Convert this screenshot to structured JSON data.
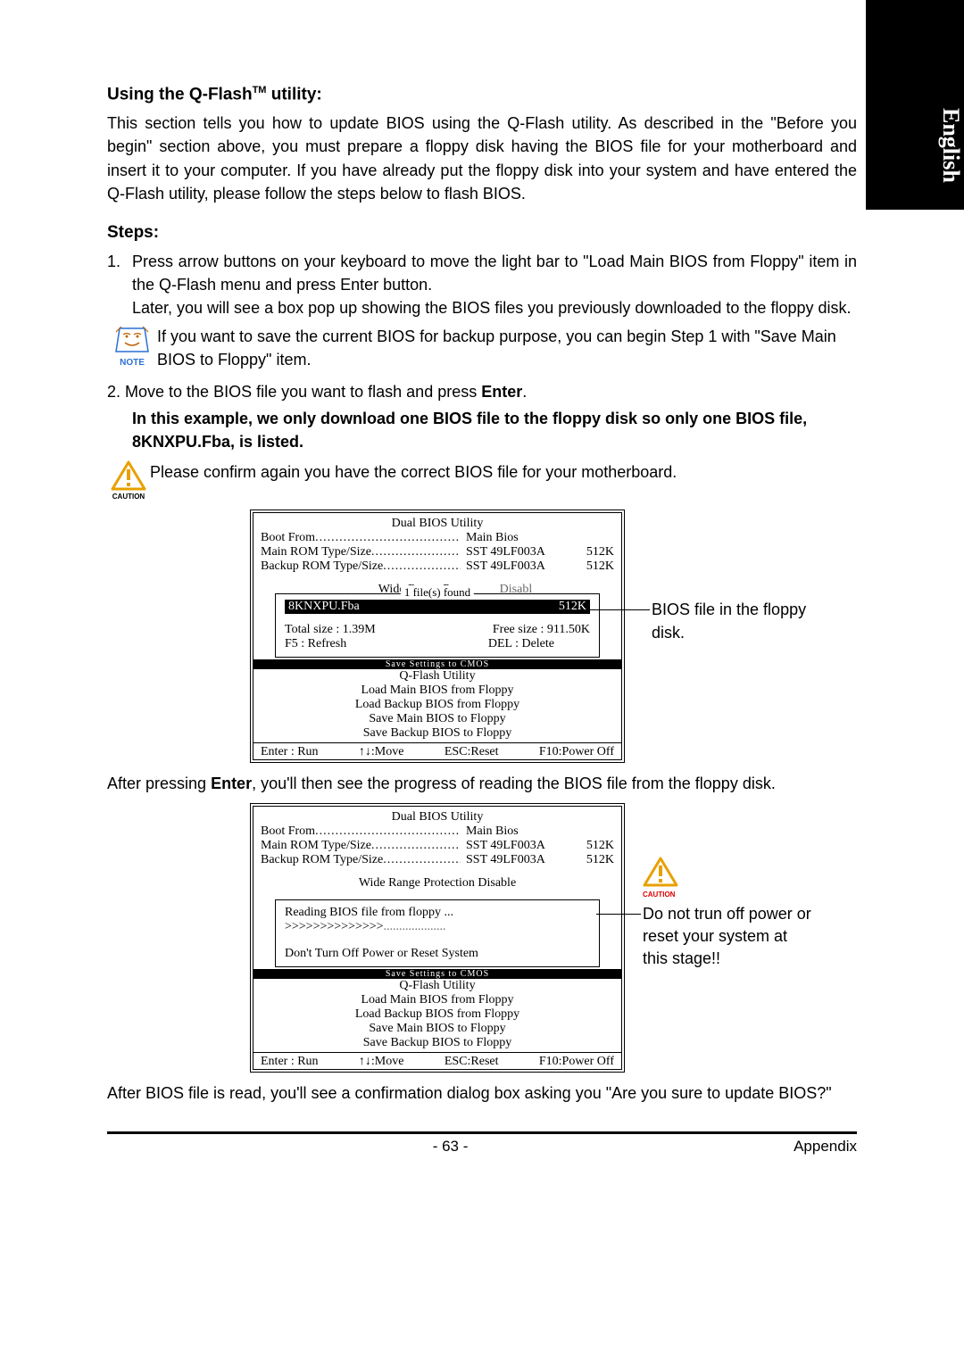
{
  "sidetab": "English",
  "heading1_pre": "Using the Q-Flash",
  "heading1_tm": "TM",
  "heading1_post": " utility:",
  "intro": "This section tells you how to update BIOS using the Q-Flash utility. As described in the \"Before you begin\" section above, you must prepare a floppy disk having the BIOS file for your motherboard and insert it to your computer. If you have already put the floppy disk into your system and have entered the Q-Flash utility, please follow the steps below to flash BIOS.",
  "steps_h": "Steps:",
  "step1_num": "1.",
  "step1a": "Press arrow buttons on your keyboard to move the light bar to \"Load Main BIOS from Floppy\" item in the Q-Flash menu and press Enter button.",
  "step1b": "Later, you will see a box pop up showing the BIOS files you previously downloaded to the floppy disk.",
  "note_label": "NOTE",
  "note_text": "If you want to save the current BIOS for backup purpose, you can begin Step 1 with \"Save Main BIOS to Floppy\" item.",
  "step2_pre": "2. Move to the BIOS file you want to flash and press ",
  "step2_enter": "Enter",
  "step2_post": ".",
  "example_line": "In this example, we only download one BIOS file to the floppy disk so only one BIOS file, 8KNXPU.Fba, is listed.",
  "caution_label": "CAUTION",
  "caution_text": "Please confirm again you have the correct BIOS file for your motherboard.",
  "bios1": {
    "title": "Dual BIOS Utility",
    "boot_from_l": "Boot From",
    "boot_from_v": "Main Bios",
    "main_rom_l": "Main ROM Type/Size",
    "main_rom_v": "SST 49LF003A",
    "main_rom_s": "512K",
    "backup_rom_l": "Backup ROM Type/Size",
    "backup_rom_v": "SST 49LF003A",
    "backup_rom_s": "512K",
    "wrp": "Wide Range Prot",
    "wrp_val_partial": "Disabl",
    "popup_label": "1 file(s) found",
    "file_name": "8KNXPU.Fba",
    "file_size": "512K",
    "total": "Total size : 1.39M",
    "free": "Free size : 911.50K",
    "f5": "F5 : Refresh",
    "del": "DEL : Delete",
    "divider": "Save Settings to CMOS",
    "util": "Q-Flash Utility",
    "m1": "Load Main BIOS from Floppy",
    "m2": "Load Backup BIOS from Floppy",
    "m3": "Save Main BIOS to Floppy",
    "m4": "Save Backup BIOS to Floppy",
    "f_run": "Enter : Run",
    "f_move": "↑↓:Move",
    "f_reset": "ESC:Reset",
    "f_power": "F10:Power Off"
  },
  "callout1": "BIOS file in the floppy disk.",
  "after1_pre": "After pressing ",
  "after1_enter": "Enter",
  "after1_post": ", you'll then see the progress of reading the BIOS file from the floppy disk.",
  "bios2": {
    "wrp_full": "Wide Range Protection    Disable",
    "reading": "Reading BIOS file from floppy ...",
    "progress": ">>>>>>>>>>>>>>",
    "dots": "....................",
    "warn": "Don't Turn Off Power or Reset System"
  },
  "callout2": "Do not trun off power or reset your system at this stage!!",
  "after2": "After BIOS file is read, you'll see a confirmation dialog box asking you \"Are you sure to update BIOS?\"",
  "page_num": "- 63 -",
  "appendix": "Appendix"
}
